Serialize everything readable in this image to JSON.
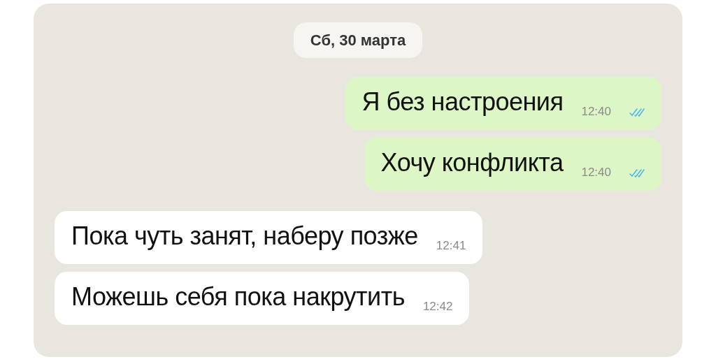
{
  "date_label": "Сб, 30 марта",
  "messages": [
    {
      "kind": "outgoing",
      "text": "Я без настроения",
      "time": "12:40",
      "read": true
    },
    {
      "kind": "outgoing",
      "text": "Хочу конфликта",
      "time": "12:40",
      "read": true
    },
    {
      "kind": "incoming",
      "text": "Пока чуть занят, наберу позже",
      "time": "12:41"
    },
    {
      "kind": "incoming",
      "text": "Можешь себя пока накрутить",
      "time": "12:42"
    }
  ]
}
